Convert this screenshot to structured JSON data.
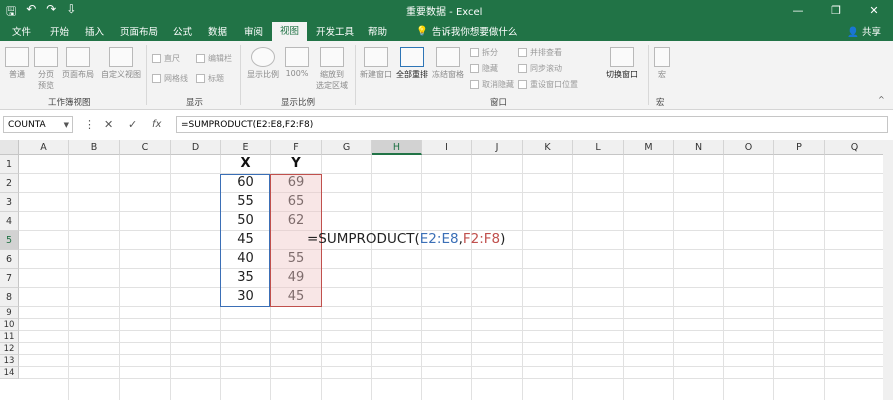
{
  "title": "重要数据 - Excel",
  "window": {
    "minimize": "—",
    "restore": "❐",
    "close": "✕"
  },
  "qat": {
    "save": "🖫",
    "undo": "↶",
    "redo": "↷",
    "more": "⇩"
  },
  "tabs": [
    "文件",
    "开始",
    "插入",
    "页面布局",
    "公式",
    "数据",
    "审阅",
    "视图",
    "开发工具",
    "帮助"
  ],
  "active_tab": "视图",
  "search_text": "告诉我你想要做什么",
  "share": "共享",
  "ribbon": {
    "workbook_views": [
      "普通",
      "分页\n预览",
      "页面布局",
      "自定义视图"
    ],
    "show": [
      "直尺",
      "编辑栏",
      "网格线",
      "标题"
    ],
    "zoom": [
      "显示比例",
      "100%",
      "缩放到\n选定区域"
    ],
    "window": [
      "新建窗口",
      "全部重排",
      "冻结窗格"
    ],
    "window_small": [
      "拆分",
      "隐藏",
      "取消隐藏"
    ],
    "window_small2": [
      "并排查看",
      "同步滚动",
      "重设窗口位置"
    ],
    "switch": "切换窗口",
    "macro": "宏",
    "groups": [
      "工作簿视图",
      "显示",
      "显示比例",
      "窗口",
      "宏"
    ],
    "collapse": "^"
  },
  "formula_bar": {
    "name_box": "COUNTA",
    "buttons": [
      "⋮",
      "✕",
      "✓",
      "fx"
    ],
    "formula": "=SUMPRODUCT(E2:E8,F2:F8)"
  },
  "columns": [
    "A",
    "B",
    "C",
    "D",
    "E",
    "F",
    "G",
    "H",
    "I",
    "J",
    "K",
    "L",
    "M",
    "N",
    "O",
    "P",
    "Q"
  ],
  "rows": [
    "1",
    "2",
    "3",
    "4",
    "5",
    "6",
    "7",
    "8",
    "9",
    "10",
    "11",
    "12",
    "13",
    "14"
  ],
  "table": {
    "header_x": "X",
    "header_y": "Y",
    "x_values": [
      "60",
      "55",
      "50",
      "45",
      "40",
      "35",
      "30"
    ],
    "y_values": [
      "69",
      "65",
      "62",
      "",
      "55",
      "49",
      "45"
    ]
  },
  "cell_formula": {
    "prefix": "=SUMPRODUCT(",
    "arg1": "E2:E8",
    "sep": ",",
    "arg2": "F2:F8",
    "suffix": ")"
  },
  "colors": {
    "excel_green": "#217346",
    "ref_blue": "#3b6fb6",
    "ref_red": "#c0504d"
  }
}
